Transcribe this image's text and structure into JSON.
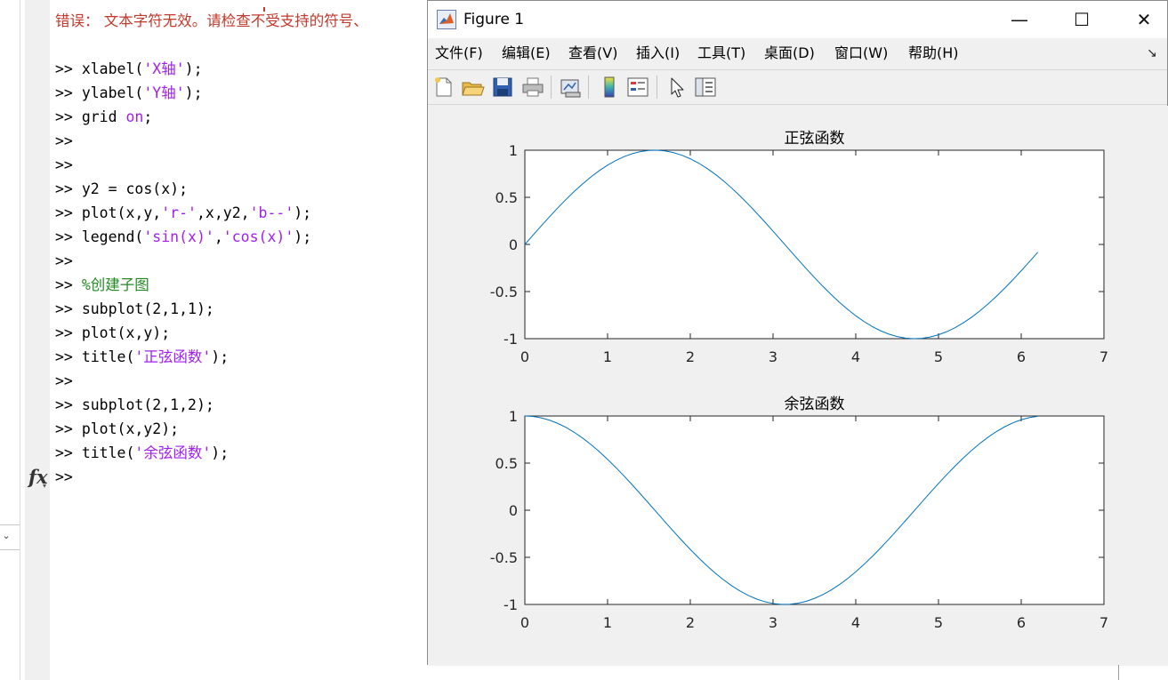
{
  "console": {
    "error_line": "错误： 文本字符无效。请检查不受支持的符号、",
    "lines": [
      {
        "prompt": ">> ",
        "parts": [
          {
            "t": "xlabel(",
            "c": "code"
          },
          {
            "t": "'X轴'",
            "c": "str"
          },
          {
            "t": ");",
            "c": "code"
          }
        ]
      },
      {
        "prompt": ">> ",
        "parts": [
          {
            "t": "ylabel(",
            "c": "code"
          },
          {
            "t": "'Y轴'",
            "c": "str"
          },
          {
            "t": ");",
            "c": "code"
          }
        ]
      },
      {
        "prompt": ">> ",
        "parts": [
          {
            "t": "grid ",
            "c": "code"
          },
          {
            "t": "on",
            "c": "str"
          },
          {
            "t": ";",
            "c": "code"
          }
        ]
      },
      {
        "prompt": ">>",
        "parts": []
      },
      {
        "prompt": ">>",
        "parts": []
      },
      {
        "prompt": ">> ",
        "parts": [
          {
            "t": "y2 = cos(x);",
            "c": "code"
          }
        ]
      },
      {
        "prompt": ">> ",
        "parts": [
          {
            "t": "plot(x,y,",
            "c": "code"
          },
          {
            "t": "'r-'",
            "c": "str"
          },
          {
            "t": ",x,y2,",
            "c": "code"
          },
          {
            "t": "'b--'",
            "c": "str"
          },
          {
            "t": ");",
            "c": "code"
          }
        ]
      },
      {
        "prompt": ">> ",
        "parts": [
          {
            "t": "legend(",
            "c": "code"
          },
          {
            "t": "'sin(x)'",
            "c": "str"
          },
          {
            "t": ",",
            "c": "code"
          },
          {
            "t": "'cos(x)'",
            "c": "str"
          },
          {
            "t": ");",
            "c": "code"
          }
        ]
      },
      {
        "prompt": ">>",
        "parts": []
      },
      {
        "prompt": ">> ",
        "parts": [
          {
            "t": "%创建子图",
            "c": "cmt"
          }
        ]
      },
      {
        "prompt": ">> ",
        "parts": [
          {
            "t": "subplot(2,1,1);",
            "c": "code"
          }
        ]
      },
      {
        "prompt": ">> ",
        "parts": [
          {
            "t": "plot(x,y);",
            "c": "code"
          }
        ]
      },
      {
        "prompt": ">> ",
        "parts": [
          {
            "t": "title(",
            "c": "code"
          },
          {
            "t": "'正弦函数'",
            "c": "str"
          },
          {
            "t": ");",
            "c": "code"
          }
        ]
      },
      {
        "prompt": ">>",
        "parts": []
      },
      {
        "prompt": ">> ",
        "parts": [
          {
            "t": "subplot(2,1,2);",
            "c": "code"
          }
        ]
      },
      {
        "prompt": ">> ",
        "parts": [
          {
            "t": "plot(x,y2);",
            "c": "code"
          }
        ]
      },
      {
        "prompt": ">> ",
        "parts": [
          {
            "t": "title(",
            "c": "code"
          },
          {
            "t": "'余弦函数'",
            "c": "str"
          },
          {
            "t": ");",
            "c": "code"
          }
        ]
      },
      {
        "prompt": ">>",
        "parts": []
      }
    ],
    "fx_icon": "fx-icon"
  },
  "figure": {
    "title": "Figure 1",
    "window_buttons": {
      "minimize": "—",
      "maximize": "☐",
      "close": "✕"
    },
    "menus": [
      "文件(F)",
      "编辑(E)",
      "查看(V)",
      "插入(I)",
      "工具(T)",
      "桌面(D)",
      "窗口(W)",
      "帮助(H)"
    ],
    "toolbar_icons": [
      "new-figure-icon",
      "open-file-icon",
      "save-icon",
      "print-icon",
      "link-plot-icon",
      "colorbar-icon",
      "legend-icon",
      "pointer-icon",
      "property-editor-icon"
    ]
  },
  "chart_data": [
    {
      "type": "line",
      "title": "正弦函数",
      "xlabel": "",
      "ylabel": "",
      "xlim": [
        0,
        7
      ],
      "ylim": [
        -1,
        1
      ],
      "xticks": [
        0,
        1,
        2,
        3,
        4,
        5,
        6,
        7
      ],
      "yticks": [
        1,
        0.5,
        0,
        -0.5,
        -1
      ],
      "ytick_labels": [
        "1",
        "0.5",
        "0",
        "-0.5",
        "-1"
      ],
      "grid": false,
      "series": [
        {
          "function": "sin",
          "x_start": 0,
          "x_end": 6.2,
          "x_step": 0.1,
          "color": "#0072bd"
        }
      ]
    },
    {
      "type": "line",
      "title": "余弦函数",
      "xlabel": "",
      "ylabel": "",
      "xlim": [
        0,
        7
      ],
      "ylim": [
        -1,
        1
      ],
      "xticks": [
        0,
        1,
        2,
        3,
        4,
        5,
        6,
        7
      ],
      "yticks": [
        1,
        0.5,
        0,
        -0.5,
        -1
      ],
      "ytick_labels": [
        "1",
        "0.5",
        "0",
        "-0.5",
        "-1"
      ],
      "grid": false,
      "series": [
        {
          "function": "cos",
          "x_start": 0,
          "x_end": 6.2,
          "x_step": 0.1,
          "color": "#0072bd"
        }
      ]
    }
  ]
}
